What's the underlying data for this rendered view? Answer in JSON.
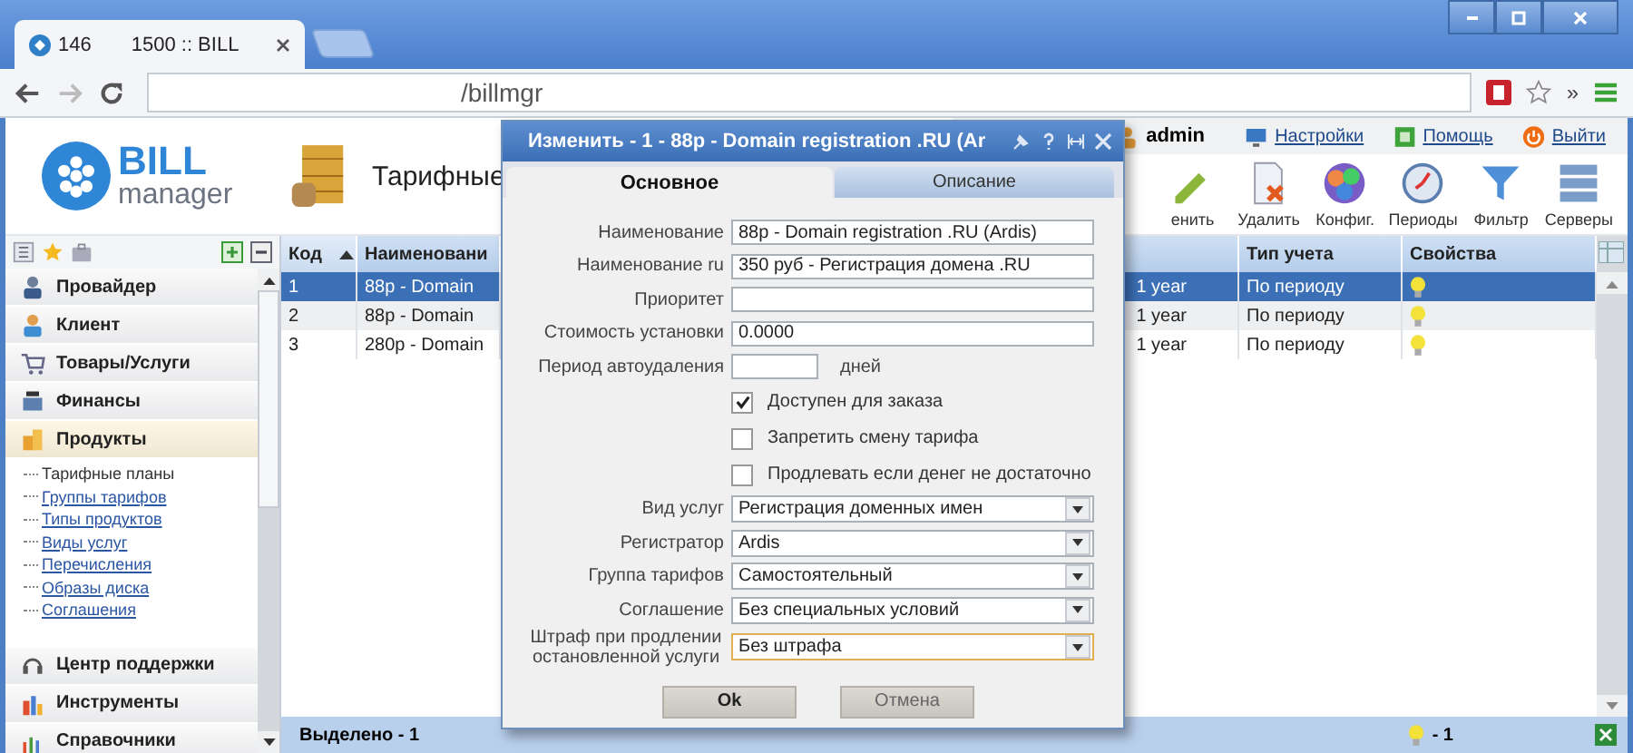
{
  "browser": {
    "tab": {
      "label_1": "146",
      "label_2": "1500 :: BILL"
    },
    "address": "/billmgr",
    "overflow": "»"
  },
  "header": {
    "logo_word": "BILL",
    "logo_sub": "manager",
    "page_title": "Тарифные",
    "user": "admin",
    "links": [
      {
        "label": "Настройки"
      },
      {
        "label": "Помощь"
      },
      {
        "label": "Выйти"
      }
    ],
    "toolbar": [
      {
        "label": "енить"
      },
      {
        "label": "Удалить"
      },
      {
        "label": "Конфиг."
      },
      {
        "label": "Периоды"
      },
      {
        "label": "Фильтр"
      },
      {
        "label": "Серверы"
      }
    ]
  },
  "sidebar": {
    "groups": [
      {
        "label": "Провайдер",
        "expanded": false
      },
      {
        "label": "Клиент",
        "expanded": false
      },
      {
        "label": "Товары/Услуги",
        "expanded": false
      },
      {
        "label": "Финансы",
        "expanded": false
      },
      {
        "label": "Продукты",
        "expanded": true,
        "children": [
          {
            "label": "Тарифные планы",
            "selected": true
          },
          {
            "label": "Группы тарифов",
            "selected": false
          },
          {
            "label": "Типы продуктов",
            "selected": false
          },
          {
            "label": "Виды услуг",
            "selected": false
          },
          {
            "label": "Перечисления",
            "selected": false
          },
          {
            "label": "Образы диска",
            "selected": false
          },
          {
            "label": "Соглашения",
            "selected": false
          }
        ]
      },
      {
        "label": "Центр поддержки",
        "expanded": false
      },
      {
        "label": "Инструменты",
        "expanded": false
      },
      {
        "label": "Справочники",
        "expanded": false
      }
    ]
  },
  "table": {
    "columns": [
      {
        "label": "Код",
        "sorted": true
      },
      {
        "label": "Наименовани",
        "sorted": false
      },
      {
        "sorted": false
      },
      {
        "label": "Тип учета",
        "sorted": false
      },
      {
        "label": "Свойства",
        "sorted": false
      }
    ],
    "rows": [
      {
        "selected": true,
        "cells": [
          "1",
          "88р - Domain",
          "1 year",
          "По периоду"
        ]
      },
      {
        "selected": false,
        "cells": [
          "2",
          "88р - Domain",
          "1 year",
          "По периоду"
        ]
      },
      {
        "selected": false,
        "cells": [
          "3",
          "280р - Domain",
          "1 year",
          "По периоду"
        ]
      }
    ],
    "footer": "Выделено - 1",
    "footer_count": "- 1"
  },
  "dialog": {
    "title": "Изменить - 1 - 88р - Domain registration .RU (Ar",
    "tabs": [
      {
        "label": "Основное",
        "selected": true
      },
      {
        "label": "Описание",
        "selected": false
      }
    ],
    "fields": [
      {
        "kind": "text",
        "label": "Наименование",
        "value": "88р - Domain registration .RU (Ardis)"
      },
      {
        "kind": "text",
        "label": "Наименование ru",
        "value": "350 руб - Регистрация домена .RU"
      },
      {
        "kind": "text",
        "label": "Приоритет"
      },
      {
        "kind": "text",
        "label": "Стоимость установки",
        "value": "0.0000"
      },
      {
        "kind": "short",
        "label": "Период автоудаления",
        "suffix": "дней"
      },
      {
        "kind": "checkbox",
        "label": "Доступен для заказа",
        "checked": true
      },
      {
        "kind": "checkbox",
        "label": "Запретить смену тарифа",
        "checked": false
      },
      {
        "kind": "checkbox",
        "label": "Продлевать если денег не достаточно",
        "checked": false
      },
      {
        "kind": "select",
        "label": "Вид услуг",
        "value": "Регистрация доменных имен",
        "focused": false
      },
      {
        "kind": "select",
        "label": "Регистратор",
        "value": "Ardis",
        "focused": false
      },
      {
        "kind": "select",
        "label": "Группа тарифов",
        "value": "Самостоятельный",
        "focused": false
      },
      {
        "kind": "select",
        "label": "Соглашение",
        "value": "Без специальных условий",
        "focused": false
      },
      {
        "kind": "select",
        "label": "Штраф при продлении остановленной услуги",
        "value": "Без штрафа",
        "focused": true
      }
    ],
    "buttons": [
      {
        "label": "Ok",
        "primary": true
      },
      {
        "label": "Отмена",
        "primary": false
      }
    ]
  }
}
